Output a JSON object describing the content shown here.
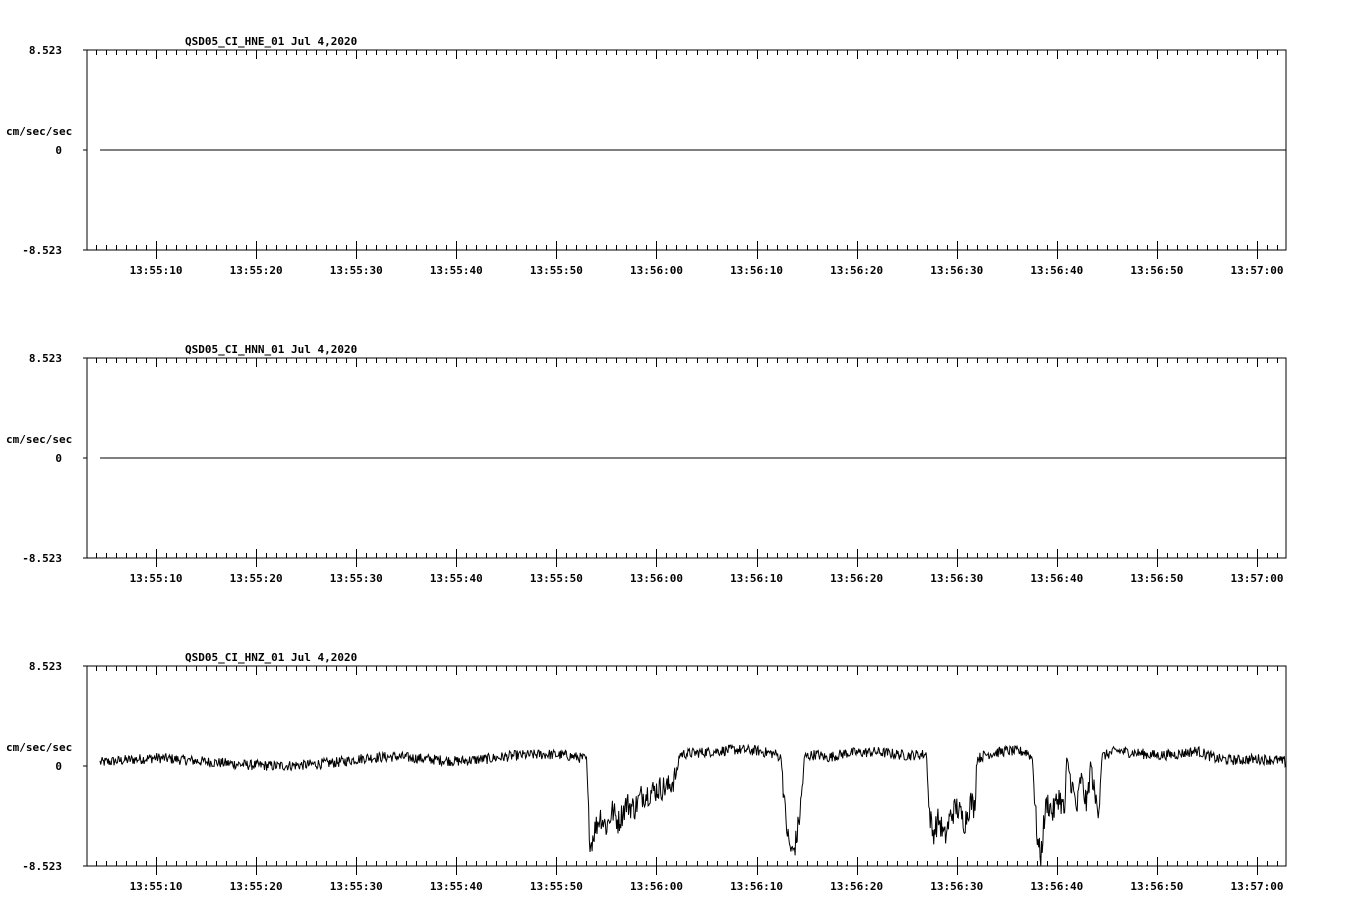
{
  "chart_data": [
    {
      "type": "line",
      "title": "QSD05_CI_HNE_01  Jul 4,2020",
      "ylabel": "cm/sec/sec",
      "ytick_labels": [
        "8.523",
        "0",
        "-8.523"
      ],
      "ylim": [
        -8.523,
        8.523
      ],
      "xtick_labels": [
        "13:55:10",
        "13:55:20",
        "13:55:30",
        "13:55:40",
        "13:55:50",
        "13:56:00",
        "13:56:10",
        "13:56:20",
        "13:56:30",
        "13:56:40",
        "13:56:50",
        "13:57:00"
      ],
      "xlim_seconds": [
        -6.9,
        112.9
      ],
      "x_start_seconds": -5.6,
      "x_end_seconds": 112.9,
      "series": [
        {
          "values": [
            0,
            0
          ]
        }
      ]
    },
    {
      "type": "line",
      "title": "QSD05_CI_HNN_01  Jul 4,2020",
      "ylabel": "cm/sec/sec",
      "ytick_labels": [
        "8.523",
        "0",
        "-8.523"
      ],
      "ylim": [
        -8.523,
        8.523
      ],
      "xtick_labels": [
        "13:55:10",
        "13:55:20",
        "13:55:30",
        "13:55:40",
        "13:55:50",
        "13:56:00",
        "13:56:10",
        "13:56:20",
        "13:56:30",
        "13:56:40",
        "13:56:50",
        "13:57:00"
      ],
      "xlim_seconds": [
        -6.9,
        112.9
      ],
      "x_start_seconds": -5.6,
      "x_end_seconds": 112.9,
      "series": [
        {
          "values": [
            0,
            0
          ]
        }
      ]
    },
    {
      "type": "line",
      "title": "QSD05_CI_HNZ_01  Jul 4,2020",
      "ylabel": "cm/sec/sec",
      "ytick_labels": [
        "8.523",
        "0",
        "-8.523"
      ],
      "ylim": [
        -8.523,
        8.523
      ],
      "xtick_labels": [
        "13:55:10",
        "13:55:20",
        "13:55:30",
        "13:55:40",
        "13:55:50",
        "13:56:00",
        "13:56:10",
        "13:56:20",
        "13:56:30",
        "13:56:40",
        "13:56:50",
        "13:57:00"
      ],
      "xlim_seconds": [
        -6.9,
        112.9
      ],
      "x_start_seconds": -5.6,
      "x_end_seconds": 112.9,
      "series": [
        {
          "points": [
            [
              -5.6,
              0.3
            ],
            [
              -3.0,
              0.5
            ],
            [
              0,
              0.7
            ],
            [
              3.0,
              0.5
            ],
            [
              6.0,
              0.3
            ],
            [
              9.0,
              0.1
            ],
            [
              12.0,
              0.0
            ],
            [
              15.0,
              0.1
            ],
            [
              18.0,
              0.3
            ],
            [
              21.0,
              0.7
            ],
            [
              24.0,
              0.8
            ],
            [
              27.0,
              0.6
            ],
            [
              30.0,
              0.4
            ],
            [
              33.0,
              0.6
            ],
            [
              36.0,
              0.9
            ],
            [
              39.0,
              1.0
            ],
            [
              41.0,
              0.9
            ],
            [
              43.0,
              0.6
            ],
            [
              43.2,
              -4.0
            ],
            [
              43.4,
              -6.8
            ],
            [
              43.8,
              -5.5
            ],
            [
              44.4,
              -4.2
            ],
            [
              45.0,
              -5.2
            ],
            [
              45.6,
              -3.8
            ],
            [
              46.2,
              -4.8
            ],
            [
              47.0,
              -3.2
            ],
            [
              47.8,
              -3.6
            ],
            [
              48.5,
              -2.5
            ],
            [
              49.5,
              -2.2
            ],
            [
              50.3,
              -1.9
            ],
            [
              51.2,
              -1.8
            ],
            [
              52.0,
              -0.8
            ],
            [
              52.3,
              1.0
            ],
            [
              55.0,
              1.2
            ],
            [
              58.0,
              1.4
            ],
            [
              60.0,
              1.3
            ],
            [
              62.0,
              1.0
            ],
            [
              62.5,
              0.6
            ],
            [
              62.8,
              -3.5
            ],
            [
              63.2,
              -6.5
            ],
            [
              63.6,
              -7.5
            ],
            [
              64.0,
              -6.2
            ],
            [
              64.4,
              -3.5
            ],
            [
              64.8,
              0.8
            ],
            [
              66.0,
              1.0
            ],
            [
              67.0,
              0.7
            ],
            [
              69.0,
              1.1
            ],
            [
              72.0,
              1.2
            ],
            [
              75.0,
              0.9
            ],
            [
              77.0,
              1.0
            ],
            [
              77.2,
              -3.5
            ],
            [
              77.6,
              -5.8
            ],
            [
              78.2,
              -4.5
            ],
            [
              78.8,
              -6.2
            ],
            [
              79.4,
              -4.2
            ],
            [
              80.0,
              -3.5
            ],
            [
              80.8,
              -4.8
            ],
            [
              81.4,
              -3.0
            ],
            [
              81.8,
              -3.6
            ],
            [
              82.0,
              0.6
            ],
            [
              83.0,
              1.0
            ],
            [
              85.0,
              1.3
            ],
            [
              87.0,
              1.2
            ],
            [
              87.6,
              0.6
            ],
            [
              87.8,
              -3.2
            ],
            [
              88.1,
              -6.5
            ],
            [
              88.4,
              -7.8
            ],
            [
              88.7,
              -5.0
            ],
            [
              89.0,
              -3.0
            ],
            [
              89.6,
              -4.0
            ],
            [
              90.2,
              -2.5
            ],
            [
              90.8,
              -4.0
            ],
            [
              91.0,
              0.6
            ],
            [
              91.6,
              -2.0
            ],
            [
              92.0,
              -3.8
            ],
            [
              92.4,
              -1.0
            ],
            [
              93.0,
              -3.4
            ],
            [
              93.4,
              0.4
            ],
            [
              93.8,
              -2.8
            ],
            [
              94.2,
              -3.5
            ],
            [
              94.5,
              0.8
            ],
            [
              96.0,
              1.3
            ],
            [
              98.0,
              1.1
            ],
            [
              100.0,
              0.9
            ],
            [
              102.0,
              1.0
            ],
            [
              104.0,
              1.3
            ],
            [
              106.0,
              0.6
            ],
            [
              108.0,
              0.5
            ],
            [
              110.0,
              0.6
            ],
            [
              112.0,
              0.5
            ],
            [
              113.0,
              0.3
            ],
            [
              114.0,
              0.5
            ],
            [
              115.0,
              0.6
            ],
            [
              116.0,
              0.5
            ],
            [
              117.0,
              0.4
            ],
            [
              118.0,
              0.5
            ],
            [
              119.0,
              0.4
            ],
            [
              120.0,
              0.5
            ]
          ]
        }
      ]
    }
  ]
}
